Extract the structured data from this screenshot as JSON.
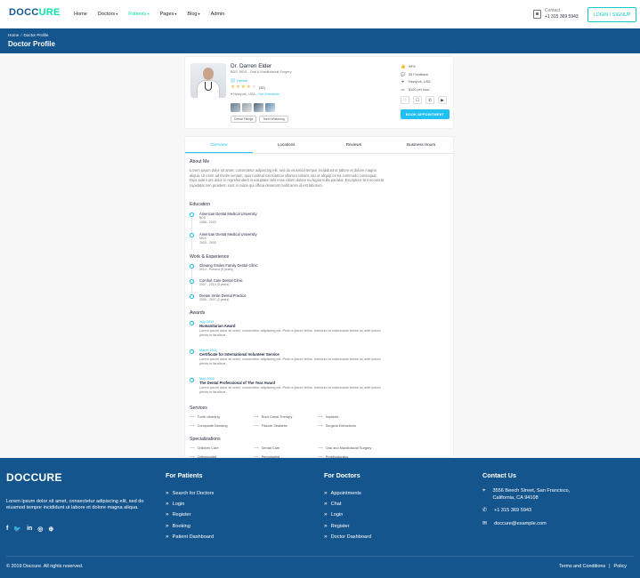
{
  "header": {
    "logo_a": "DOCC",
    "logo_b": "URE",
    "nav": [
      {
        "label": "Home",
        "caret": ""
      },
      {
        "label": "Doctors",
        "caret": "▾"
      },
      {
        "label": "Patients",
        "caret": "▾"
      },
      {
        "label": "Pages",
        "caret": "▾"
      },
      {
        "label": "Blog",
        "caret": "▾"
      },
      {
        "label": "Admin",
        "caret": ""
      }
    ],
    "contact_label": "Contact",
    "contact_phone": "+1 315 369 5943",
    "login_label": "LOGIN / SIGNUP"
  },
  "breadcrumb": {
    "home": "Home",
    "sep": "/",
    "current": "Doctor Profile",
    "title": "Doctor Profile"
  },
  "doctor": {
    "name": "Dr. Darren Elder",
    "speciality": "BDS, MDS - Oral & Maxillofacial Surgery",
    "department": "Dentist",
    "rating_count": "(35)",
    "location": "Newyork, USA - ",
    "directions": "Get Directions",
    "tags": [
      "Dental Fillings",
      "Teeth Whitening"
    ],
    "stats": [
      {
        "icon": "👍",
        "text": "99%"
      },
      {
        "icon": "💬",
        "text": "35 Feedback"
      },
      {
        "icon": "⌖",
        "text": "Newyork, USA"
      },
      {
        "icon": "▭",
        "text": "$100 per hour"
      }
    ],
    "action_icons": [
      "♡",
      "☐",
      "✆",
      "▶"
    ],
    "book_label": "BOOK APPOINTMENT"
  },
  "tabs": [
    "Overview",
    "Locations",
    "Reviews",
    "Business Hours"
  ],
  "overview": {
    "about_h": "About Me",
    "about_text": "Lorem ipsum dolor sit amet, consectetur adipiscing elit, sed do eiusmod tempor incididunt ut labore et dolore magna aliqua. Ut enim ad minim veniam, quis nostrud exercitation ullamco laboris nisi ut aliquip ex ea commodo consequat. Duis aute irure dolor in reprehenderit in voluptate velit esse cillum dolore eu fugiat nulla pariatur. Excepteur sint occaecat cupidatat non proident, sunt in culpa qui officia deserunt mollit anim id est laborum.",
    "education_h": "Education",
    "education": [
      {
        "title": "American Dental Medical University",
        "degree": "BDS",
        "years": "1998 - 2003"
      },
      {
        "title": "American Dental Medical University",
        "degree": "MDS",
        "years": "2003 - 2005"
      }
    ],
    "work_h": "Work & Experience",
    "work": [
      {
        "title": "Glowing Smiles Family Dental Clinic",
        "years": "2010 - Present (5 years)"
      },
      {
        "title": "Comfort Care Dental Clinic",
        "years": "2007 - 2010 (3 years)"
      },
      {
        "title": "Dream Smile Dental Practice",
        "years": "2005 - 2007 (2 years)"
      }
    ],
    "awards_h": "Awards",
    "awards": [
      {
        "date": "July 2019",
        "title": "Humanitarian Award",
        "desc": "Lorem ipsum dolor sit amet, consectetur adipiscing elit. Proin a ipsum tellus. Interdum et malesuada fames ac ante ipsum primis in faucibus."
      },
      {
        "date": "March 2011",
        "title": "Certificate for International Volunteer Service",
        "desc": "Lorem ipsum dolor sit amet, consectetur adipiscing elit. Proin a ipsum tellus. Interdum et malesuada fames ac ante ipsum primis in faucibus."
      },
      {
        "date": "May 2008",
        "title": "The Dental Professional of The Year Award",
        "desc": "Lorem ipsum dolor sit amet, consectetur adipiscing elit. Proin a ipsum tellus. Interdum et malesuada fames ac ante ipsum primis in faucibus."
      }
    ],
    "services_h": "Services",
    "services": [
      "Tooth cleaning",
      "Root Canal Therapy",
      "Implants",
      "Composite Bonding",
      "Fissure Sealants",
      "Surgical Extractions"
    ],
    "specializations_h": "Specializations",
    "specializations": [
      "Children Care",
      "Dental Care",
      "Oral and Maxillofacial Surgery",
      "Orthodontist",
      "Periodontist",
      "Prosthodontics"
    ]
  },
  "footer": {
    "logo_a": "DOCC",
    "logo_b": "URE",
    "about": "Lorem ipsum dolor sit amet, consectetur adipiscing elit, sed do eiusmod tempor incididunt ut labore et dolore magna aliqua.",
    "social": [
      "f",
      "🐦",
      "in",
      "◎",
      "⊕"
    ],
    "patients_h": "For Patients",
    "patients_links": [
      "Search for Doctors",
      "Login",
      "Register",
      "Booking",
      "Patient Dashboard"
    ],
    "doctors_h": "For Doctors",
    "doctors_links": [
      "Appointments",
      "Chat",
      "Login",
      "Register",
      "Doctor Dashboard"
    ],
    "contact_h": "Contact Us",
    "address": "3556 Beech Street, San Francisco, California, CA 94108",
    "phone": "+1 315 369 5943",
    "email": "doccure@example.com",
    "copyright": "© 2019 Doccure. All rights reserved.",
    "terms": "Terms and Conditions",
    "pipe": "|",
    "policy": "Policy"
  },
  "colors": {
    "primary": "#15558d",
    "accent": "#20c0f3",
    "teal": "#09e5ab"
  }
}
